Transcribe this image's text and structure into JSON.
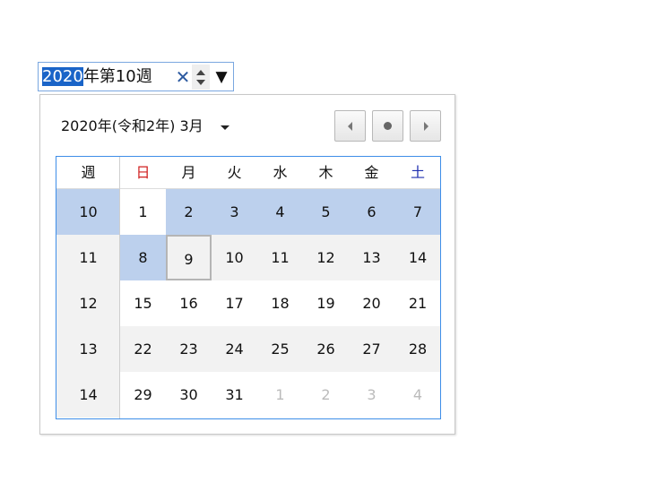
{
  "input": {
    "selected_text": "2020",
    "rest_text": "年第10週",
    "clear_glyph": "✕",
    "dropdown_glyph": "▼"
  },
  "calendar": {
    "title": "2020年(令和2年) 3月",
    "headers": [
      "週",
      "日",
      "月",
      "火",
      "水",
      "木",
      "金",
      "土"
    ],
    "rows": [
      {
        "week": "10",
        "days": [
          "1",
          "2",
          "3",
          "4",
          "5",
          "6",
          "7"
        ]
      },
      {
        "week": "11",
        "days": [
          "8",
          "9",
          "10",
          "11",
          "12",
          "13",
          "14"
        ]
      },
      {
        "week": "12",
        "days": [
          "15",
          "16",
          "17",
          "18",
          "19",
          "20",
          "21"
        ]
      },
      {
        "week": "13",
        "days": [
          "22",
          "23",
          "24",
          "25",
          "26",
          "27",
          "28"
        ]
      },
      {
        "week": "14",
        "days": [
          "29",
          "30",
          "31",
          "1",
          "2",
          "3",
          "4"
        ]
      }
    ],
    "selected_week": "10",
    "selected_date": "8",
    "today": "9"
  },
  "colors": {
    "accent": "#3e8ee8",
    "selection": "#bcd0ed",
    "sunday": "#d02020",
    "saturday": "#2030b0",
    "outside_month": "#bbbbbb"
  },
  "icons": {
    "prev": "chevron-left-icon",
    "today": "dot-icon",
    "next": "chevron-right-icon",
    "clear": "close-icon",
    "spin": "spinner-icon",
    "dropdown": "caret-down-icon"
  }
}
